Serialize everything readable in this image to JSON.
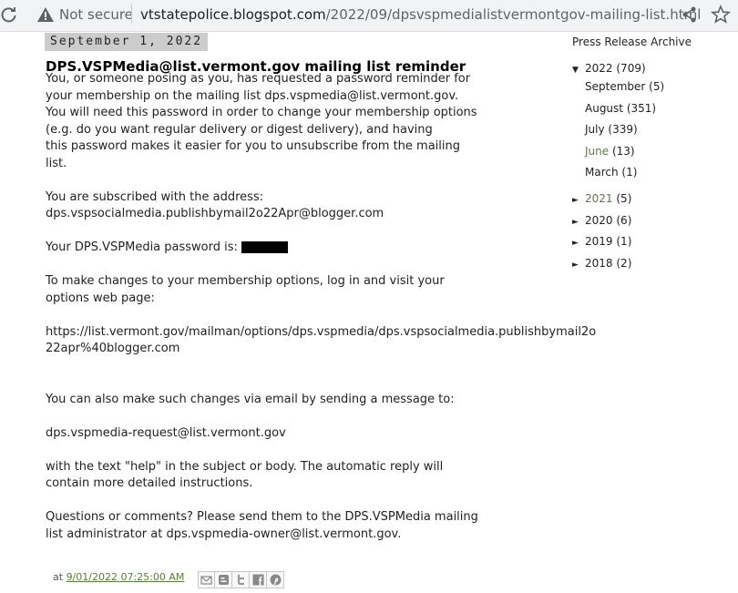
{
  "browser": {
    "security_label": "Not secure",
    "url_host": "vtstatepolice.blogspot.com",
    "url_path": "/2022/09/dpsvspmedialistvermontgov-mailing-list.html"
  },
  "post": {
    "date": "September 1, 2022",
    "title": "DPS.VSPMedia@list.vermont.gov mailing list reminder",
    "paragraphs": [
      "You, or someone posing as you, has requested a password reminder for\nyour membership on the mailing list dps.vspmedia@list.vermont.gov.\nYou will need this password in order to change your membership options\n(e.g. do you want regular delivery or digest delivery), and having\nthis password makes it easier for you to unsubscribe from the mailing\nlist.",
      "You are subscribed with the address:\ndps.vspsocialmedia.publishbymail2o22Apr@blogger.com",
      "Your DPS.VSPMedia password is:",
      "To make changes to your membership options, log in and visit your\noptions web page:",
      "https://list.vermont.gov/mailman/options/dps.vspmedia/dps.vspsocialmedia.publishbymail2o\n22apr%40blogger.com",
      "You can also make such changes via email by sending a message to:",
      "dps.vspmedia-request@list.vermont.gov",
      "with the text \"help\" in the subject or body. The automatic reply will\ncontain more detailed instructions.",
      "Questions or comments? Please send them to the DPS.VSPMedia mailing\nlist administrator at dps.vspmedia-owner@list.vermont.gov."
    ],
    "footer_prefix": "at",
    "timestamp": "9/01/2022 07:25:00 AM"
  },
  "sidebar": {
    "title": "Press Release Archive",
    "years": [
      {
        "label": "2022",
        "count": "(709)",
        "expanded": true
      },
      {
        "label": "2021",
        "count": "(5)"
      },
      {
        "label": "2020",
        "count": "(6)"
      },
      {
        "label": "2019",
        "count": "(1)"
      },
      {
        "label": "2018",
        "count": "(2)"
      }
    ],
    "months": [
      {
        "label": "September",
        "count": "(5)"
      },
      {
        "label": "August",
        "count": "(351)"
      },
      {
        "label": "July",
        "count": "(339)"
      },
      {
        "label": "June",
        "count": "(13)"
      },
      {
        "label": "March",
        "count": "(1)"
      }
    ]
  },
  "colors": {
    "link_green": "#5a7d3d",
    "date_bg": "#cccccc"
  }
}
